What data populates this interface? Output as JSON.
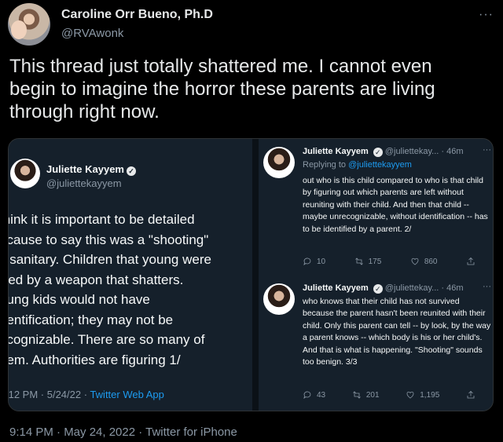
{
  "tweet": {
    "author_name": "Caroline Orr Bueno, Ph.D",
    "author_handle": "@RVAwonk",
    "more_label": "···",
    "text": "This thread just totally shattered me. I cannot even begin to imagine the horror these parents are living through right now.",
    "meta": "9:14 PM · May 24, 2022 · Twitter for iPhone"
  },
  "embed": {
    "left": {
      "name": "Juliette Kayyem",
      "verified_glyph": "✓",
      "handle": "@juliettekayyem",
      "text": "think it is important to be detailed\necause to say this was a \"shooting\"\ns sanitary. Children that young were\nilled by a weapon that shatters.\noung kids would not have\ndentification; they may not be\necognizable. There are so many of\nhem. Authorities are figuring  1/",
      "meta_time": ":12 PM · 5/24/22 · ",
      "meta_app": "Twitter Web App"
    },
    "right": [
      {
        "name": "Juliette Kayyem",
        "verified_glyph": "✓",
        "handle_time": "@juliettekay... · 46m",
        "more": "···",
        "reply_prefix": "Replying to ",
        "reply_to": "@juliettekayyem",
        "body": "out who is this child compared to who is that child by figuring out which parents are left without reuniting with their child. And then that child -- maybe unrecognizable, without identification -- has to be identified by a parent. 2/",
        "replies": "10",
        "retweets": "175",
        "likes": "860"
      },
      {
        "name": "Juliette Kayyem",
        "verified_glyph": "✓",
        "handle_time": "@juliettekay... · 46m",
        "more": "···",
        "body": "who knows that their child has not survived because the parent hasn't been reunited with their child. Only this parent can tell -- by look, by the way a parent knows -- which body is his or her child's. And that is what is happening. \"Shooting\" sounds too benign. 3/3",
        "replies": "43",
        "retweets": "201",
        "likes": "1,195"
      }
    ]
  }
}
